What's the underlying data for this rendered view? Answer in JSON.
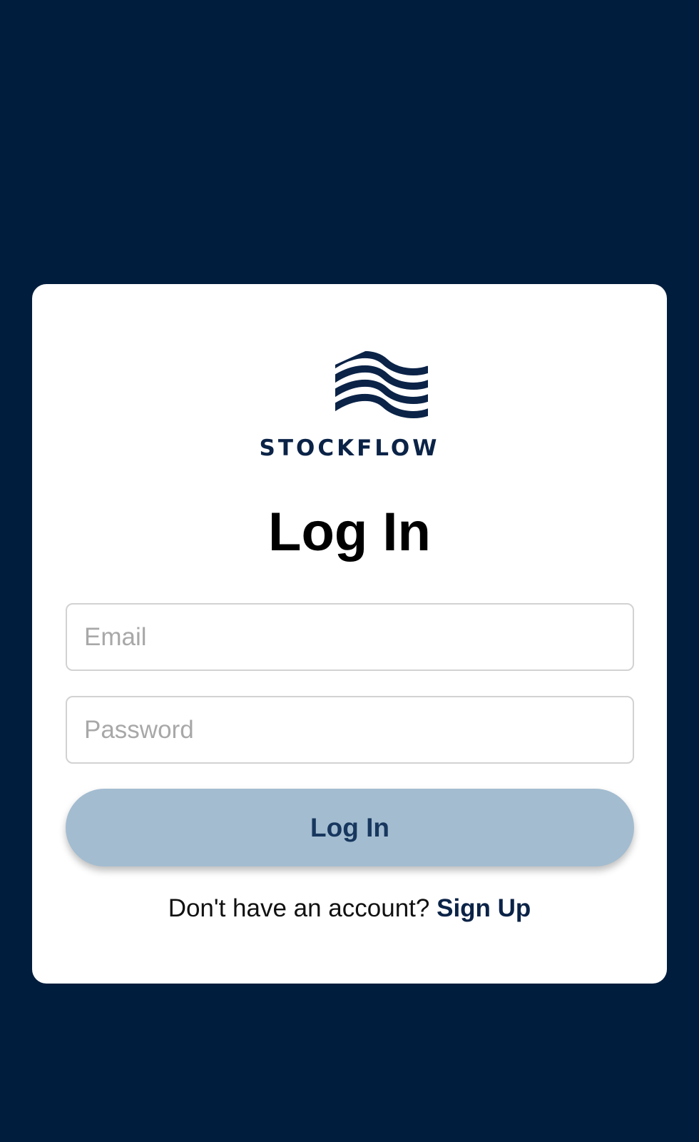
{
  "brand": {
    "name": "STOCKFLOW",
    "logo_icon": "stacked-waves-logo-icon",
    "color": "#0b2347"
  },
  "form": {
    "title": "Log In",
    "email": {
      "placeholder": "Email",
      "value": ""
    },
    "password": {
      "placeholder": "Password",
      "value": ""
    },
    "submit_label": "Log In"
  },
  "footer": {
    "prompt": "Don't have an account?",
    "link_label": "Sign Up"
  },
  "colors": {
    "background": "#001d3d",
    "card": "#ffffff",
    "button": "#a3bcd0",
    "button_text": "#17375e"
  }
}
